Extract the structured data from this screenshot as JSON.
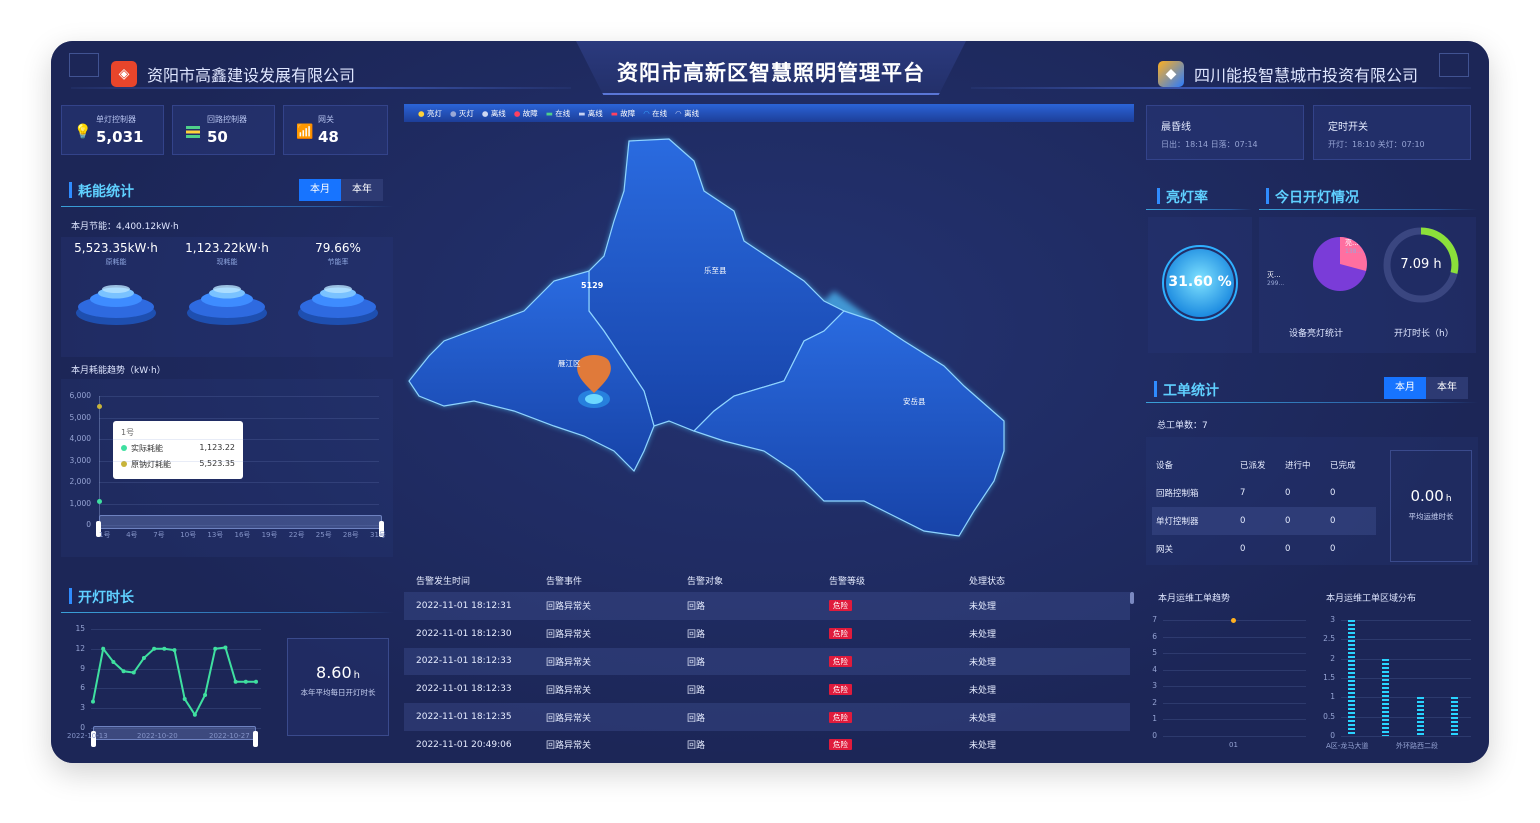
{
  "header": {
    "title": "资阳市高新区智慧照明管理平台",
    "company_left": "资阳市高鑫建设发展有限公司",
    "company_right": "四川能投智慧城市投资有限公司"
  },
  "stats": [
    {
      "label": "单灯控制器",
      "value": "5,031",
      "icon": "bulb-icon"
    },
    {
      "label": "回路控制器",
      "value": "50",
      "icon": "loop-icon"
    },
    {
      "label": "网关",
      "value": "48",
      "icon": "gateway-icon"
    }
  ],
  "energy": {
    "title": "耗能统计",
    "tabs": [
      "本月",
      "本年"
    ],
    "saving_label": "本月节能：4,400.12kW·h",
    "cards": [
      {
        "value": "5,523.35kW·h",
        "label": "原耗能"
      },
      {
        "value": "1,123.22kW·h",
        "label": "现耗能"
      },
      {
        "value": "79.66%",
        "label": "节能率"
      }
    ],
    "trend_title": "本月耗能趋势（kW·h）",
    "y_ticks": [
      "6,000",
      "5,000",
      "4,000",
      "3,000",
      "2,000",
      "1,000",
      "0"
    ],
    "x_ticks": [
      "1号",
      "4号",
      "7号",
      "10号",
      "13号",
      "16号",
      "19号",
      "22号",
      "25号",
      "28号",
      "31号"
    ],
    "tooltip": {
      "day": "1号",
      "actual_label": "实际耗能",
      "actual_value": "1,123.22",
      "orig_label": "原钠灯耗能",
      "orig_value": "5,523.35"
    }
  },
  "lighting": {
    "title": "开灯时长",
    "y_ticks": [
      "15",
      "12",
      "9",
      "6",
      "3",
      "0"
    ],
    "x_ticks": [
      "2022-10-13",
      "2022-10-20",
      "2022-10-27"
    ],
    "avg_value": "8.60",
    "avg_unit": "h",
    "avg_label": "本年平均每日开灯时长"
  },
  "chart_data": [
    {
      "type": "line",
      "title": "本月耗能趋势（kW·h）",
      "ylim": [
        0,
        6000
      ],
      "series": [
        {
          "name": "实际耗能",
          "x": [
            "1号"
          ],
          "values": [
            1123.22
          ]
        },
        {
          "name": "原钠灯耗能",
          "x": [
            "1号"
          ],
          "values": [
            5523.35
          ]
        }
      ]
    },
    {
      "type": "line",
      "title": "开灯时长",
      "ylim": [
        0,
        15
      ],
      "values": [
        4,
        12,
        10,
        8.6,
        8.4,
        10.6,
        12,
        12,
        11.8,
        4.4,
        2,
        5,
        12,
        12.2,
        7,
        7,
        7
      ]
    },
    {
      "type": "line",
      "title": "本月运维工单趋势",
      "ylim": [
        0,
        7
      ],
      "categories": [
        "01"
      ],
      "values": [
        7
      ]
    },
    {
      "type": "bar",
      "title": "本月运维工单区域分布",
      "ylim": [
        0,
        3
      ],
      "categories": [
        "A区-龙马大道",
        "",
        "外环路西二段",
        ""
      ],
      "values": [
        3,
        2,
        1,
        1
      ]
    }
  ],
  "map": {
    "legend": [
      "亮灯",
      "灭灯",
      "离线",
      "故障",
      "在线",
      "离线",
      "故障",
      "在线",
      "离线"
    ],
    "regions": [
      "乐至县",
      "雁江区",
      "安岳县"
    ],
    "marker_value": "5129"
  },
  "alarms": {
    "headers": [
      "告警发生时间",
      "告警事件",
      "告警对象",
      "告警等级",
      "处理状态"
    ],
    "rows": [
      [
        "2022-11-01 18:12:31",
        "回路异常关",
        "回路",
        "危险",
        "未处理"
      ],
      [
        "2022-11-01 18:12:30",
        "回路异常关",
        "回路",
        "危险",
        "未处理"
      ],
      [
        "2022-11-01 18:12:33",
        "回路异常关",
        "回路",
        "危险",
        "未处理"
      ],
      [
        "2022-11-01 18:12:33",
        "回路异常关",
        "回路",
        "危险",
        "未处理"
      ],
      [
        "2022-11-01 18:12:35",
        "回路异常关",
        "回路",
        "危险",
        "未处理"
      ],
      [
        "2022-11-01 20:49:06",
        "回路异常关",
        "回路",
        "危险",
        "未处理"
      ]
    ]
  },
  "right": {
    "dawn_title": "晨昏线",
    "dawn_sub": "日出：18:14 日落：07:14",
    "timer_title": "定时开关",
    "timer_sub": "开灯：18:10 关灯：07:10",
    "rate_title": "亮灯率",
    "rate_value": "31.60 %",
    "today_title": "今日开灯情况",
    "pie_on": "亮...",
    "pie_on_count": "138...",
    "pie_off": "灭...",
    "pie_off_count": "299...",
    "pie_caption": "设备亮灯统计",
    "ring_value": "7.09 h",
    "ring_caption": "开灯时长（h）",
    "workorder_title": "工单统计",
    "tabs": [
      "本月",
      "本年"
    ],
    "total": "总工单数：7",
    "wo_headers": [
      "设备",
      "已派发",
      "进行中",
      "已完成"
    ],
    "wo_rows": [
      [
        "回路控制箱",
        "7",
        "0",
        "0"
      ],
      [
        "单灯控制器",
        "0",
        "0",
        "0"
      ],
      [
        "网关",
        "0",
        "0",
        "0"
      ]
    ],
    "avg_value": "0.00",
    "avg_unit": "h",
    "avg_label": "平均运维时长",
    "trend_title": "本月运维工单趋势",
    "trend_y": [
      "7",
      "6",
      "5",
      "4",
      "3",
      "2",
      "1",
      "0"
    ],
    "trend_x": [
      "01"
    ],
    "dist_title": "本月运维工单区域分布",
    "dist_y": [
      "3",
      "2.5",
      "2",
      "1.5",
      "1",
      "0.5",
      "0"
    ],
    "dist_x": [
      "A区-龙马大道",
      "外环路西二段"
    ]
  },
  "colors": {
    "accent": "#1774ff",
    "danger": "#e01b3c",
    "cyan": "#5fd0ff",
    "green": "#3fe0a0"
  }
}
